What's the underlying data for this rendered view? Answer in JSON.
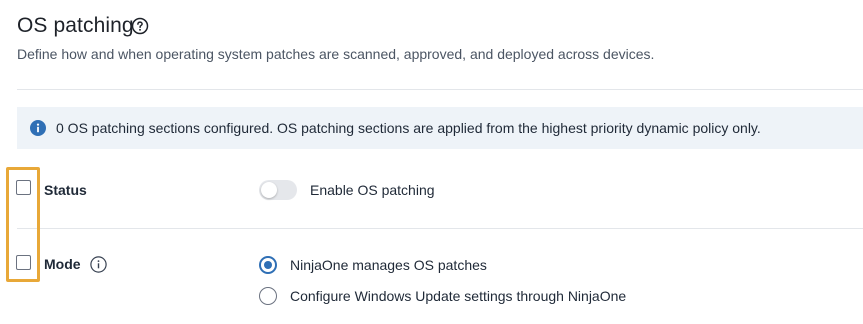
{
  "header": {
    "title": "OS patching",
    "subtitle": "Define how and when operating system patches are scanned, approved, and deployed across devices.",
    "help_icon": "question-circle-icon"
  },
  "banner": {
    "icon": "info-circle-icon",
    "text": "0 OS patching sections configured. OS patching sections are applied from the highest priority dynamic policy only."
  },
  "status_row": {
    "label": "Status",
    "checked": false,
    "toggle": {
      "on": false,
      "label": "Enable OS patching"
    }
  },
  "mode_row": {
    "label": "Mode",
    "checked": false,
    "info_icon": "info-icon",
    "options": [
      {
        "label": "NinjaOne manages OS patches",
        "selected": true
      },
      {
        "label": "Configure Windows Update settings through NinjaOne",
        "selected": false
      }
    ]
  },
  "colors": {
    "accent": "#2f6fb5",
    "highlight": "#e8a838",
    "banner_bg": "#eef3f8"
  }
}
